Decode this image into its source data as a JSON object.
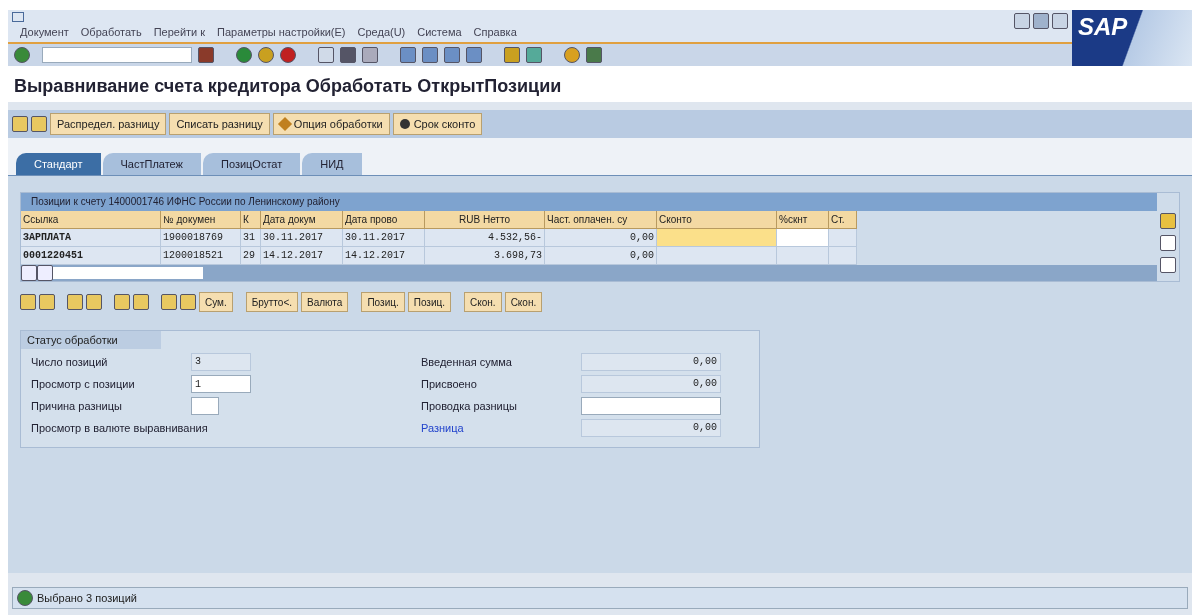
{
  "menu": [
    "Документ",
    "Обработать",
    "Перейти к",
    "Параметры настройки(E)",
    "Среда(U)",
    "Система",
    "Справка"
  ],
  "logo": "SAP",
  "title": "Выравнивание счета кредитора Обработать ОткрытПозиции",
  "app_buttons": [
    "Распредел. разницу",
    "Списать разницу",
    "Опция обработки",
    "Срок сконто"
  ],
  "tabs": [
    {
      "label": "Стандарт",
      "selected": true
    },
    {
      "label": "ЧастПлатеж",
      "selected": false
    },
    {
      "label": "ПозицОстат",
      "selected": false
    },
    {
      "label": "НИД",
      "selected": false
    }
  ],
  "table": {
    "title": "Позиции к счету 1400001746 ИФНС России по Ленинскому району",
    "columns": [
      "Ссылка",
      "№ докумен",
      "К",
      "Дата докум",
      "Дата прово",
      "RUB Нетто",
      "Част. оплачен. су",
      "Сконто",
      "%скнт",
      "Ст."
    ],
    "rows": [
      {
        "cells": [
          "ЗАРПЛАТА",
          "1900018769",
          "31",
          "30.11.2017",
          "30.11.2017",
          "4.532,56-",
          "0,00"
        ],
        "editable": true
      },
      {
        "cells": [
          "0001220451",
          "1200018521",
          "29",
          "14.12.2017",
          "14.12.2017",
          "3.698,73",
          "0,00"
        ],
        "editable": false
      }
    ]
  },
  "grid_buttons": [
    "Сум.",
    "Брутто<.",
    "Валюта",
    "Позиц.",
    "Позиц.",
    "Скон.",
    "Скон."
  ],
  "status": {
    "title": "Статус обработки",
    "left": [
      {
        "label": "Число позиций",
        "value": "3",
        "kind": "display"
      },
      {
        "label": "Просмотр с позиции",
        "value": "1",
        "kind": "input"
      },
      {
        "label": "Причина разницы",
        "kind": "input_small"
      },
      {
        "label": "Просмотр в валюте выравнивания",
        "kind": "none"
      }
    ],
    "right": [
      {
        "label": "Введенная сумма",
        "value": "0,00",
        "kind": "display",
        "highlight": false
      },
      {
        "label": "Присвоено",
        "value": "0,00",
        "kind": "display",
        "highlight": false
      },
      {
        "label": "Проводка разницы",
        "kind": "input",
        "highlight": false
      },
      {
        "label": "Разница",
        "value": "0,00",
        "kind": "display",
        "highlight": true
      }
    ]
  },
  "status_bar": "Выбрано 3 позиций"
}
